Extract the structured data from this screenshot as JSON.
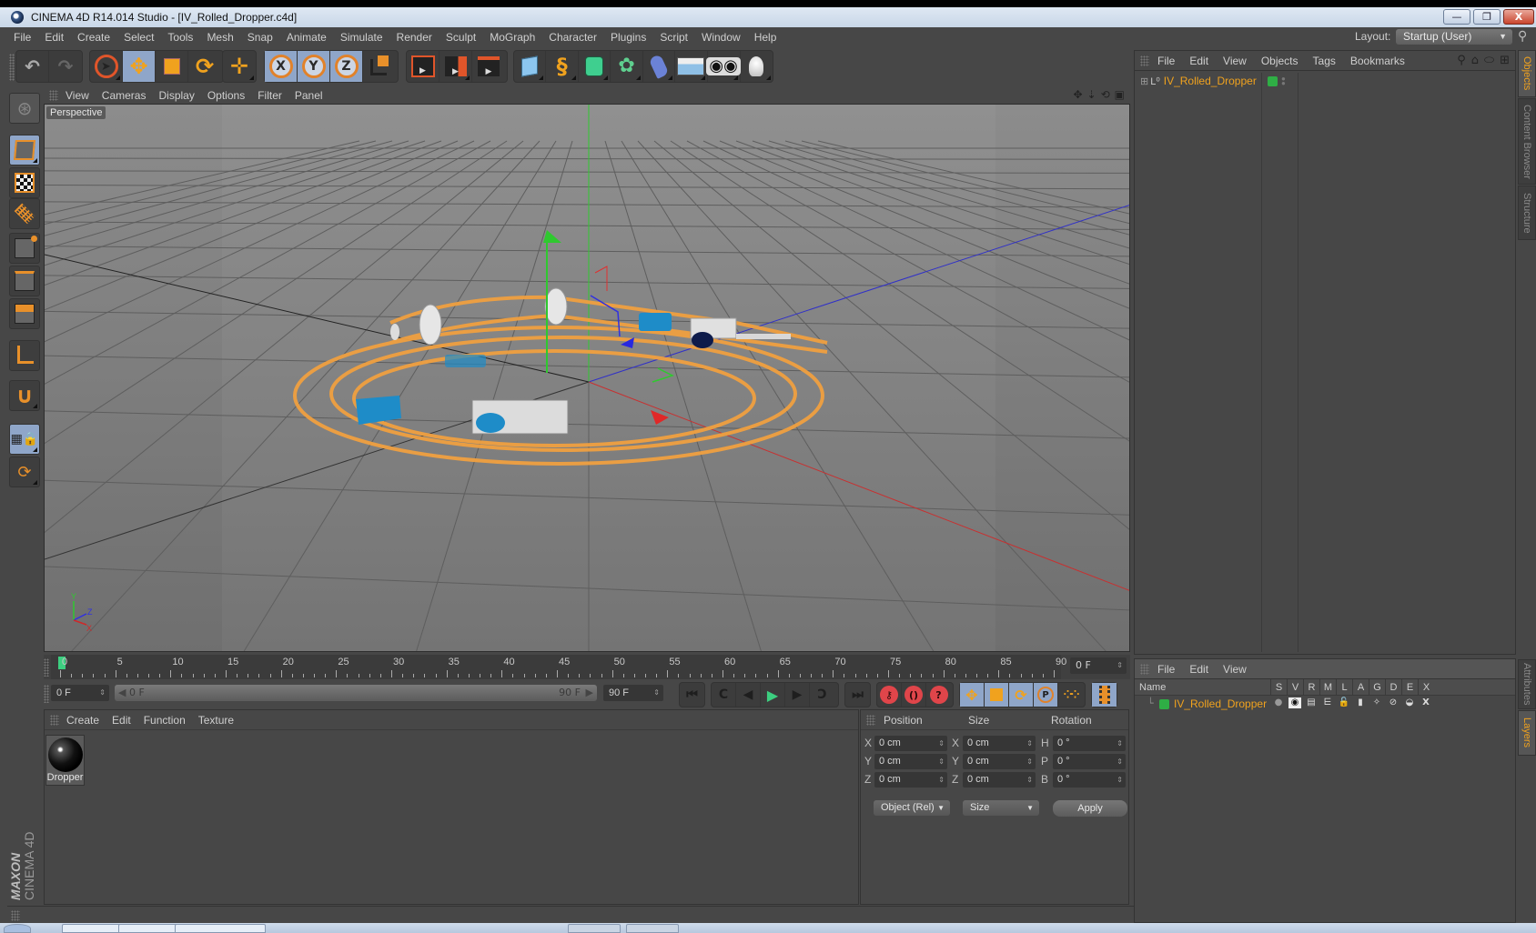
{
  "window": {
    "title": "CINEMA 4D R14.014 Studio - [IV_Rolled_Dropper.c4d]",
    "controls": {
      "minimize": "—",
      "restore": "❐",
      "close": "X"
    }
  },
  "menubar": {
    "items": [
      "File",
      "Edit",
      "Create",
      "Select",
      "Tools",
      "Mesh",
      "Snap",
      "Animate",
      "Simulate",
      "Render",
      "Sculpt",
      "MoGraph",
      "Character",
      "Plugins",
      "Script",
      "Window",
      "Help"
    ],
    "layout_label": "Layout:",
    "layout_value": "Startup (User)"
  },
  "toolbar": {
    "groups": [
      {
        "name": "history",
        "buttons": [
          "undo-icon",
          "redo-icon"
        ]
      },
      {
        "name": "tools",
        "buttons": [
          "live-selection-icon",
          "move-icon",
          "scale-icon",
          "rotate-icon"
        ]
      },
      {
        "name": "recent",
        "buttons": [
          "recent-tool-move-icon"
        ]
      },
      {
        "name": "axes",
        "buttons": [
          "x-axis-lock-icon",
          "y-axis-lock-icon",
          "z-axis-lock-icon",
          "coordinate-system-icon"
        ]
      },
      {
        "name": "render",
        "buttons": [
          "render-view-icon",
          "render-picture-viewer-icon",
          "render-settings-icon"
        ]
      },
      {
        "name": "create",
        "buttons": [
          "cube-icon",
          "spline-pen-icon",
          "subdivision-surface-icon",
          "cloner-icon",
          "deformer-icon",
          "floor-icon",
          "camera-icon",
          "light-icon"
        ]
      }
    ],
    "axis_labels": [
      "X",
      "Y",
      "Z"
    ]
  },
  "left_palette": {
    "buttons": [
      "make-editable-icon",
      "model-mode-icon",
      "texture-mode-icon",
      "workplane-mode-icon",
      "points-mode-icon",
      "edges-mode-icon",
      "polygons-mode-icon",
      "enable-axis-icon",
      "snapping-icon",
      "locked-workplane-icon",
      "planar-workplane-icon"
    ]
  },
  "viewport": {
    "menu": [
      "View",
      "Cameras",
      "Display",
      "Options",
      "Filter",
      "Panel"
    ],
    "label": "Perspective",
    "axis_labels": {
      "x": "X",
      "y": "Y",
      "z": "Z"
    },
    "colors": {
      "background": "#8b8b8b",
      "spline": "#f0a040",
      "x_axis": "#d83030",
      "y_axis": "#30c030",
      "z_axis": "#3030d8",
      "part_blue": "#1e8cc8",
      "part_white": "#e0e0e0"
    }
  },
  "timeline": {
    "ticks": [
      "0",
      "5",
      "10",
      "15",
      "20",
      "25",
      "30",
      "35",
      "40",
      "45",
      "50",
      "55",
      "60",
      "65",
      "70",
      "75",
      "80",
      "85",
      "90"
    ],
    "current_frame": "0 F",
    "start_field": "0 F",
    "range_start": "0 F",
    "range_end": "90 F",
    "end_field": "90 F",
    "playhead_frame": 0
  },
  "playback": {
    "buttons": [
      "go-to-start-icon",
      "previous-key-icon",
      "previous-frame-icon",
      "play-icon",
      "next-frame-icon",
      "next-key-icon",
      "go-to-end-icon"
    ],
    "record_buttons": [
      "record-active-objects-icon",
      "autokeying-icon",
      "keyframe-selection-icon"
    ],
    "key_buttons": [
      "record-position-icon",
      "record-scale-icon",
      "record-rotation-icon",
      "record-parameter-icon",
      "record-point-level-icon"
    ],
    "timeline_button": "timeline-icon"
  },
  "materials": {
    "menu": [
      "Create",
      "Edit",
      "Function",
      "Texture"
    ],
    "items": [
      {
        "name": "Dropper"
      }
    ]
  },
  "coordinates": {
    "headers": {
      "position": "Position",
      "size": "Size",
      "rotation": "Rotation"
    },
    "rows": [
      {
        "pos_label": "X",
        "pos": "0 cm",
        "size_label": "X",
        "size": "0 cm",
        "rot_label": "H",
        "rot": "0 °"
      },
      {
        "pos_label": "Y",
        "pos": "0 cm",
        "size_label": "Y",
        "size": "0 cm",
        "rot_label": "P",
        "rot": "0 °"
      },
      {
        "pos_label": "Z",
        "pos": "0 cm",
        "size_label": "Z",
        "size": "0 cm",
        "rot_label": "B",
        "rot": "0 °"
      }
    ],
    "mode_dropdown": "Object (Rel)",
    "size_dropdown": "Size",
    "apply_label": "Apply"
  },
  "objects_panel": {
    "menu": [
      "File",
      "Edit",
      "View",
      "Objects",
      "Tags",
      "Bookmarks"
    ],
    "tools": [
      "search-icon",
      "home-icon",
      "visibility-icon",
      "new-window-icon"
    ],
    "items": [
      {
        "name": "IV_Rolled_Dropper",
        "layer_color": "#2fae45"
      }
    ]
  },
  "layers_panel": {
    "menu": [
      "File",
      "Edit",
      "View"
    ],
    "columns": [
      "Name",
      "S",
      "V",
      "R",
      "M",
      "L",
      "A",
      "G",
      "D",
      "E",
      "X"
    ],
    "items": [
      {
        "name": "IV_Rolled_Dropper",
        "color": "#2fae45"
      }
    ]
  },
  "right_tabs": {
    "top": [
      {
        "label": "Objects",
        "active": true
      },
      {
        "label": "Content Browser",
        "active": false
      },
      {
        "label": "Structure",
        "active": false
      }
    ],
    "bottom": [
      {
        "label": "Attributes",
        "active": false
      },
      {
        "label": "Layers",
        "active": true
      }
    ]
  },
  "branding": {
    "maxon": "MAXON",
    "product": "CINEMA 4D"
  }
}
